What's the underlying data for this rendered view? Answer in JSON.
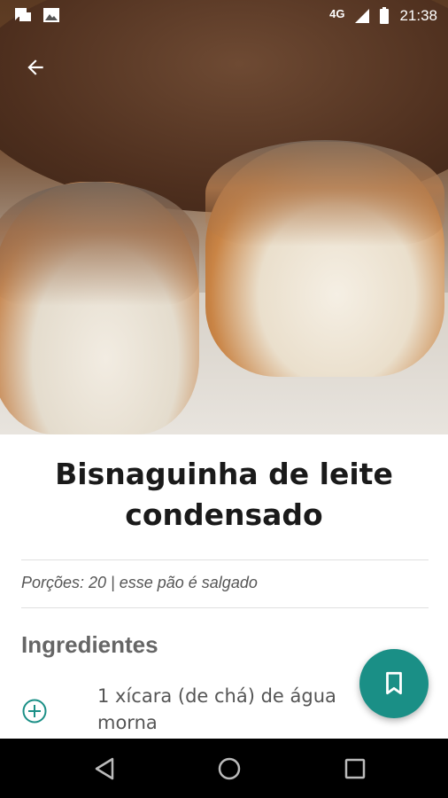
{
  "status_bar": {
    "network": "4G",
    "time": "21:38"
  },
  "recipe": {
    "title": "Bisnaguinha de leite condensado",
    "portions_text": "Porções: 20 | esse pão é salgado",
    "ingredients_heading": "Ingredientes",
    "ingredients": [
      {
        "text": "1 xícara (de chá) de água morna"
      }
    ]
  },
  "icons": {
    "back": "arrow-left-icon",
    "add": "plus-circle-icon",
    "bookmark": "bookmark-icon",
    "nav_back": "triangle-back-icon",
    "nav_home": "circle-home-icon",
    "nav_recents": "square-recents-icon"
  },
  "colors": {
    "accent": "#1a8f86",
    "title_text": "#1a1a1a",
    "secondary_text": "#555555"
  }
}
